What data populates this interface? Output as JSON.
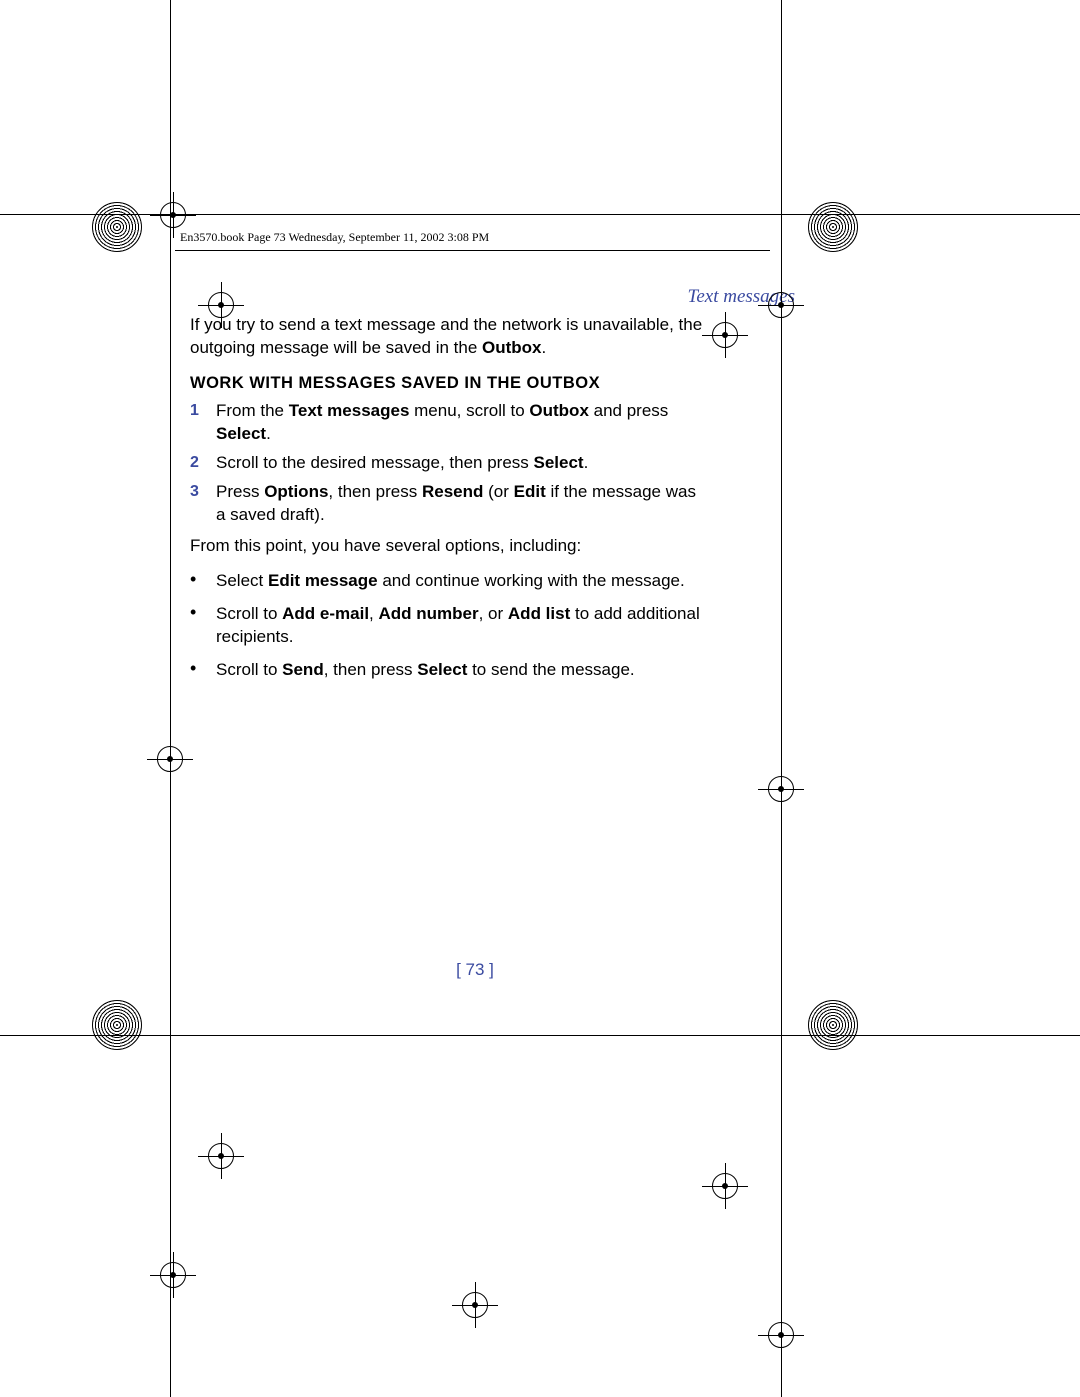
{
  "header_line": "En3570.book  Page 73  Wednesday, September 11, 2002  3:08 PM",
  "section_header": "Text messages",
  "intro_pre": "If you try to send a text message and the network is unavailable, the outgoing message will be saved in the ",
  "intro_bold": "Outbox",
  "intro_post": ".",
  "subhead": "WORK WITH MESSAGES SAVED IN THE OUTBOX",
  "steps": [
    {
      "num": "1",
      "runs": [
        {
          "t": "From the "
        },
        {
          "t": "Text messages",
          "b": true
        },
        {
          "t": " menu, scroll to "
        },
        {
          "t": "Outbox",
          "b": true
        },
        {
          "t": " and press "
        },
        {
          "t": "Select",
          "b": true
        },
        {
          "t": "."
        }
      ]
    },
    {
      "num": "2",
      "runs": [
        {
          "t": "Scroll to the desired message, then press "
        },
        {
          "t": "Select",
          "b": true
        },
        {
          "t": "."
        }
      ]
    },
    {
      "num": "3",
      "runs": [
        {
          "t": "Press "
        },
        {
          "t": "Options",
          "b": true
        },
        {
          "t": ", then press "
        },
        {
          "t": "Resend",
          "b": true
        },
        {
          "t": " (or "
        },
        {
          "t": "Edit",
          "b": true
        },
        {
          "t": " if the message was a saved draft)."
        }
      ]
    }
  ],
  "after_steps": "From this point, you have several options, including:",
  "bullets": [
    {
      "runs": [
        {
          "t": "Select "
        },
        {
          "t": "Edit message",
          "b": true
        },
        {
          "t": " and continue working with the message."
        }
      ]
    },
    {
      "runs": [
        {
          "t": "Scroll to "
        },
        {
          "t": "Add e-mail",
          "b": true
        },
        {
          "t": ", "
        },
        {
          "t": "Add number",
          "b": true
        },
        {
          "t": ", or "
        },
        {
          "t": "Add list",
          "b": true
        },
        {
          "t": " to add additional recipients."
        }
      ]
    },
    {
      "runs": [
        {
          "t": "Scroll to "
        },
        {
          "t": "Send",
          "b": true
        },
        {
          "t": ", then press "
        },
        {
          "t": "Select",
          "b": true
        },
        {
          "t": " to send the message."
        }
      ]
    }
  ],
  "page_number": "[ 73 ]"
}
